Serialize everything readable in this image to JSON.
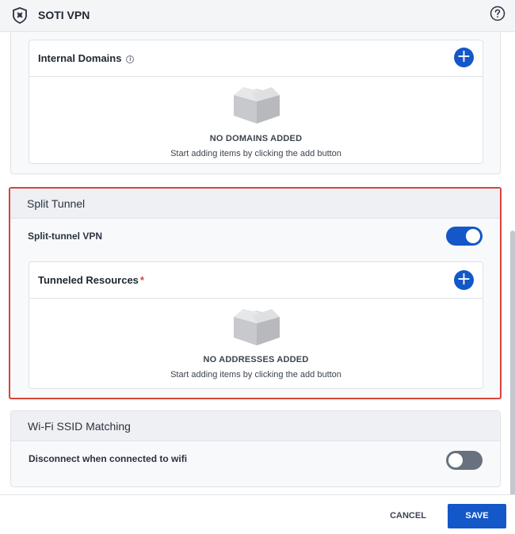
{
  "header": {
    "title": "SOTI VPN",
    "logo_icon": "soti-shield-icon",
    "help_icon": "help-circle-icon"
  },
  "internal_domains": {
    "title": "Internal Domains",
    "info_icon": "info-icon",
    "empty_title": "NO DOMAINS ADDED",
    "empty_subtitle": "Start adding items by clicking the add button"
  },
  "split_tunnel": {
    "section_title": "Split Tunnel",
    "toggle_label": "Split-tunnel VPN",
    "toggle_on": true,
    "resources_title": "Tunneled Resources",
    "required_mark": "*",
    "empty_title": "NO ADDRESSES ADDED",
    "empty_subtitle": "Start adding items by clicking the add button"
  },
  "wifi": {
    "section_title": "Wi-Fi SSID Matching",
    "toggle_label": "Disconnect when connected to wifi",
    "toggle_on": false
  },
  "footer": {
    "cancel_label": "CANCEL",
    "save_label": "SAVE"
  },
  "colors": {
    "accent": "#1357c9",
    "error_outline": "#d9433c",
    "toggle_off": "#68717e"
  }
}
